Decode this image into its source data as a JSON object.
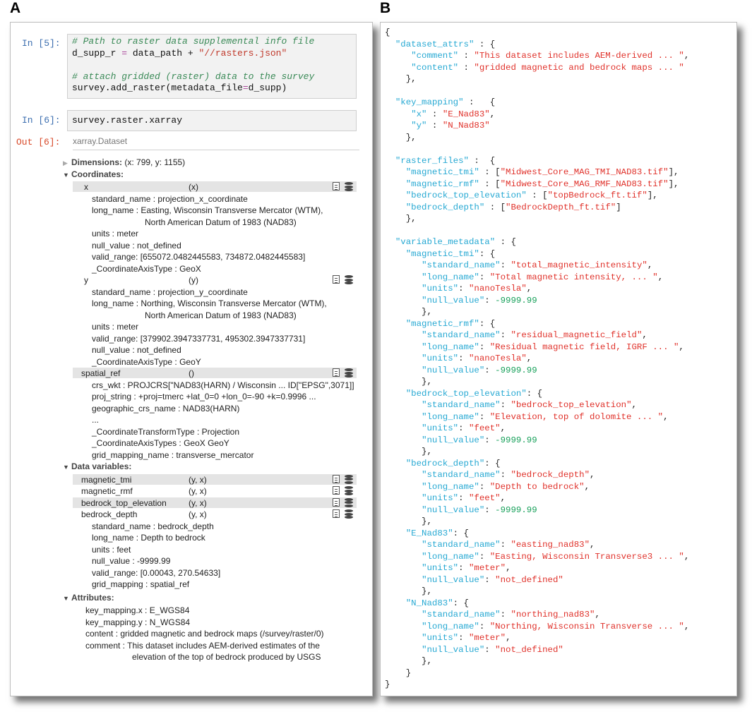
{
  "panel_labels": {
    "a": "A",
    "b": "B"
  },
  "notebook": {
    "cell5": {
      "prompt": "In [5]:",
      "lines": [
        [
          {
            "t": "# Path to raster data supplemental info file",
            "c": "comment"
          }
        ],
        [
          {
            "t": "d_supp_r ",
            "c": ""
          },
          {
            "t": "=",
            "c": "op"
          },
          {
            "t": " data_path + ",
            "c": ""
          },
          {
            "t": "\"//rasters.json\"",
            "c": "str"
          }
        ],
        [
          {
            "t": "",
            "c": ""
          }
        ],
        [
          {
            "t": "# attach gridded (raster) data to the survey",
            "c": "comment"
          }
        ],
        [
          {
            "t": "survey.add_raster(metadata_file",
            "c": ""
          },
          {
            "t": "=",
            "c": "op"
          },
          {
            "t": "d_supp)",
            "c": ""
          }
        ]
      ]
    },
    "cell6": {
      "prompt": "In [6]:",
      "code": "survey.raster.xarray",
      "out_prompt": "Out [6]:",
      "out_type": "xarray.Dataset"
    },
    "dimensions": {
      "label": "Dimensions:",
      "value": "(x: 799, y: 1155)"
    },
    "coordinates_label": "Coordinates:",
    "coords": [
      {
        "name": "x",
        "dims": "(x)",
        "attrs": [
          "standard_name : projection_x_coordinate",
          "long_name : Easting, Wisconsin Transverse Mercator (WTM),",
          "North American Datum of 1983 (NAD83)",
          "units : meter",
          "null_value : not_defined",
          "valid_range: [655072.0482445583, 734872.0482445583]",
          "_CoordinateAxisType : GeoX"
        ]
      },
      {
        "name": "y",
        "dims": "(y)",
        "attrs": [
          "standard_name : projection_y_coordinate",
          "long_name : Northing, Wisconsin Transverse Mercator (WTM),",
          "North American Datum of 1983 (NAD83)",
          "units : meter",
          "valid_range: [379902.3947337731, 495302.3947337731]",
          "null_value : not_defined",
          "_CoordinateAxisType : GeoY"
        ]
      },
      {
        "name": "spatial_ref",
        "dims": "()",
        "attrs": [
          "crs_wkt : PROJCRS[\"NAD83(HARN) / Wisconsin ... ID[\"EPSG\",3071]]",
          "proj_string : +proj=tmerc +lat_0=0 +lon_0=-90 +k=0.9996 ...",
          "geographic_crs_name : NAD83(HARN)",
          "...",
          "_CoordinateTransformType : Projection",
          "_CoordinateAxisTypes : GeoX GeoY",
          "grid_mapping_name : transverse_mercator"
        ]
      }
    ],
    "data_variables_label": "Data variables:",
    "data_vars": [
      {
        "name": "magnetic_tmi",
        "dims": "(y, x)"
      },
      {
        "name": "magnetic_rmf",
        "dims": "(y, x)"
      },
      {
        "name": "bedrock_top_elevation",
        "dims": "(y, x)"
      },
      {
        "name": "bedrock_depth",
        "dims": "(y, x)"
      }
    ],
    "bedrock_depth_attrs": [
      "standard_name : bedrock_depth",
      "long_name : Depth to bedrock",
      "units : feet",
      "null_value : -9999.99",
      "valid_range: [0.00043, 270.54633]",
      "grid_mapping : spatial_ref"
    ],
    "attributes_label": "Attributes:",
    "attributes": [
      "key_mapping.x : E_WGS84",
      "key_mapping.y : N_WGS84",
      "content : gridded magnetic and bedrock maps (/survey/raster/0)",
      "comment : This dataset includes AEM-derived estimates of the",
      "elevation of the top of bedrock produced by USGS"
    ]
  },
  "json_lines": [
    [
      {
        "t": "{",
        "c": ""
      }
    ],
    [
      {
        "t": "  ",
        "c": ""
      },
      {
        "t": "\"dataset_attrs\"",
        "c": "key"
      },
      {
        "t": " : {",
        "c": ""
      }
    ],
    [
      {
        "t": "     ",
        "c": ""
      },
      {
        "t": "\"comment\"",
        "c": "key"
      },
      {
        "t": " : ",
        "c": ""
      },
      {
        "t": "\"This dataset includes AEM-derived ... \"",
        "c": "str"
      },
      {
        "t": ",",
        "c": ""
      }
    ],
    [
      {
        "t": "     ",
        "c": ""
      },
      {
        "t": "\"content\"",
        "c": "key"
      },
      {
        "t": " : ",
        "c": ""
      },
      {
        "t": "\"gridded magnetic and bedrock maps ... \"",
        "c": "str"
      }
    ],
    [
      {
        "t": "    },",
        "c": ""
      }
    ],
    [
      {
        "t": "",
        "c": ""
      }
    ],
    [
      {
        "t": "  ",
        "c": ""
      },
      {
        "t": "\"key_mapping\"",
        "c": "key"
      },
      {
        "t": " :   {",
        "c": ""
      }
    ],
    [
      {
        "t": "     ",
        "c": ""
      },
      {
        "t": "\"x\"",
        "c": "key"
      },
      {
        "t": " : ",
        "c": ""
      },
      {
        "t": "\"E_Nad83\"",
        "c": "str"
      },
      {
        "t": ",",
        "c": ""
      }
    ],
    [
      {
        "t": "     ",
        "c": ""
      },
      {
        "t": "\"y\"",
        "c": "key"
      },
      {
        "t": " : ",
        "c": ""
      },
      {
        "t": "\"N_Nad83\"",
        "c": "str"
      }
    ],
    [
      {
        "t": "    },",
        "c": ""
      }
    ],
    [
      {
        "t": "",
        "c": ""
      }
    ],
    [
      {
        "t": "  ",
        "c": ""
      },
      {
        "t": "\"raster_files\"",
        "c": "key"
      },
      {
        "t": " :  {",
        "c": ""
      }
    ],
    [
      {
        "t": "    ",
        "c": ""
      },
      {
        "t": "\"magnetic_tmi\"",
        "c": "key"
      },
      {
        "t": " : [",
        "c": ""
      },
      {
        "t": "\"Midwest_Core_MAG_TMI_NAD83.tif\"",
        "c": "str"
      },
      {
        "t": "],",
        "c": ""
      }
    ],
    [
      {
        "t": "    ",
        "c": ""
      },
      {
        "t": "\"magnetic_rmf\"",
        "c": "key"
      },
      {
        "t": " : [",
        "c": ""
      },
      {
        "t": "\"Midwest_Core_MAG_RMF_NAD83.tif\"",
        "c": "str"
      },
      {
        "t": "],",
        "c": ""
      }
    ],
    [
      {
        "t": "    ",
        "c": ""
      },
      {
        "t": "\"bedrock_top_elevation\"",
        "c": "key"
      },
      {
        "t": " : [",
        "c": ""
      },
      {
        "t": "\"topBedrock_ft.tif\"",
        "c": "str"
      },
      {
        "t": "],",
        "c": ""
      }
    ],
    [
      {
        "t": "    ",
        "c": ""
      },
      {
        "t": "\"bedrock_depth\"",
        "c": "key"
      },
      {
        "t": " : [",
        "c": ""
      },
      {
        "t": "\"BedrockDepth_ft.tif\"",
        "c": "str"
      },
      {
        "t": "]",
        "c": ""
      }
    ],
    [
      {
        "t": "    },",
        "c": ""
      }
    ],
    [
      {
        "t": "",
        "c": ""
      }
    ],
    [
      {
        "t": "  ",
        "c": ""
      },
      {
        "t": "\"variable_metadata\"",
        "c": "key"
      },
      {
        "t": " : {",
        "c": ""
      }
    ],
    [
      {
        "t": "    ",
        "c": ""
      },
      {
        "t": "\"magnetic_tmi\"",
        "c": "key"
      },
      {
        "t": ": {",
        "c": ""
      }
    ],
    [
      {
        "t": "       ",
        "c": ""
      },
      {
        "t": "\"standard_name\"",
        "c": "key"
      },
      {
        "t": ": ",
        "c": ""
      },
      {
        "t": "\"total_magnetic_intensity\"",
        "c": "str"
      },
      {
        "t": ",",
        "c": ""
      }
    ],
    [
      {
        "t": "       ",
        "c": ""
      },
      {
        "t": "\"long_name\"",
        "c": "key"
      },
      {
        "t": ": ",
        "c": ""
      },
      {
        "t": "\"Total magnetic intensity, ... \"",
        "c": "str"
      },
      {
        "t": ",",
        "c": ""
      }
    ],
    [
      {
        "t": "       ",
        "c": ""
      },
      {
        "t": "\"units\"",
        "c": "key"
      },
      {
        "t": ": ",
        "c": ""
      },
      {
        "t": "\"nanoTesla\"",
        "c": "str"
      },
      {
        "t": ",",
        "c": ""
      }
    ],
    [
      {
        "t": "       ",
        "c": ""
      },
      {
        "t": "\"null_value\"",
        "c": "key"
      },
      {
        "t": ": ",
        "c": ""
      },
      {
        "t": "-9999.99",
        "c": "num"
      }
    ],
    [
      {
        "t": "       },",
        "c": ""
      }
    ],
    [
      {
        "t": "    ",
        "c": ""
      },
      {
        "t": "\"magnetic_rmf\"",
        "c": "key"
      },
      {
        "t": ": {",
        "c": ""
      }
    ],
    [
      {
        "t": "       ",
        "c": ""
      },
      {
        "t": "\"standard_name\"",
        "c": "key"
      },
      {
        "t": ": ",
        "c": ""
      },
      {
        "t": "\"residual_magnetic_field\"",
        "c": "str"
      },
      {
        "t": ",",
        "c": ""
      }
    ],
    [
      {
        "t": "       ",
        "c": ""
      },
      {
        "t": "\"long_name\"",
        "c": "key"
      },
      {
        "t": ": ",
        "c": ""
      },
      {
        "t": "\"Residual magnetic field, IGRF ... \"",
        "c": "str"
      },
      {
        "t": ",",
        "c": ""
      }
    ],
    [
      {
        "t": "       ",
        "c": ""
      },
      {
        "t": "\"units\"",
        "c": "key"
      },
      {
        "t": ": ",
        "c": ""
      },
      {
        "t": "\"nanoTesla\"",
        "c": "str"
      },
      {
        "t": ",",
        "c": ""
      }
    ],
    [
      {
        "t": "       ",
        "c": ""
      },
      {
        "t": "\"null_value\"",
        "c": "key"
      },
      {
        "t": ": ",
        "c": ""
      },
      {
        "t": "-9999.99",
        "c": "num"
      }
    ],
    [
      {
        "t": "       },",
        "c": ""
      }
    ],
    [
      {
        "t": "    ",
        "c": ""
      },
      {
        "t": "\"bedrock_top_elevation\"",
        "c": "key"
      },
      {
        "t": ": {",
        "c": ""
      }
    ],
    [
      {
        "t": "       ",
        "c": ""
      },
      {
        "t": "\"standard_name\"",
        "c": "key"
      },
      {
        "t": ": ",
        "c": ""
      },
      {
        "t": "\"bedrock_top_elevation\"",
        "c": "str"
      },
      {
        "t": ",",
        "c": ""
      }
    ],
    [
      {
        "t": "       ",
        "c": ""
      },
      {
        "t": "\"long_name\"",
        "c": "key"
      },
      {
        "t": ": ",
        "c": ""
      },
      {
        "t": "\"Elevation, top of dolomite ... \"",
        "c": "str"
      },
      {
        "t": ",",
        "c": ""
      }
    ],
    [
      {
        "t": "       ",
        "c": ""
      },
      {
        "t": "\"units\"",
        "c": "key"
      },
      {
        "t": ": ",
        "c": ""
      },
      {
        "t": "\"feet\"",
        "c": "str"
      },
      {
        "t": ",",
        "c": ""
      }
    ],
    [
      {
        "t": "       ",
        "c": ""
      },
      {
        "t": "\"null_value\"",
        "c": "key"
      },
      {
        "t": ": ",
        "c": ""
      },
      {
        "t": "-9999.99",
        "c": "num"
      }
    ],
    [
      {
        "t": "       },",
        "c": ""
      }
    ],
    [
      {
        "t": "    ",
        "c": ""
      },
      {
        "t": "\"bedrock_depth\"",
        "c": "key"
      },
      {
        "t": ": {",
        "c": ""
      }
    ],
    [
      {
        "t": "       ",
        "c": ""
      },
      {
        "t": "\"standard_name\"",
        "c": "key"
      },
      {
        "t": ": ",
        "c": ""
      },
      {
        "t": "\"bedrock_depth\"",
        "c": "str"
      },
      {
        "t": ",",
        "c": ""
      }
    ],
    [
      {
        "t": "       ",
        "c": ""
      },
      {
        "t": "\"long_name\"",
        "c": "key"
      },
      {
        "t": ": ",
        "c": ""
      },
      {
        "t": "\"Depth to bedrock\"",
        "c": "str"
      },
      {
        "t": ",",
        "c": ""
      }
    ],
    [
      {
        "t": "       ",
        "c": ""
      },
      {
        "t": "\"units\"",
        "c": "key"
      },
      {
        "t": ": ",
        "c": ""
      },
      {
        "t": "\"feet\"",
        "c": "str"
      },
      {
        "t": ",",
        "c": ""
      }
    ],
    [
      {
        "t": "       ",
        "c": ""
      },
      {
        "t": "\"null_value\"",
        "c": "key"
      },
      {
        "t": ": ",
        "c": ""
      },
      {
        "t": "-9999.99",
        "c": "num"
      }
    ],
    [
      {
        "t": "       },",
        "c": ""
      }
    ],
    [
      {
        "t": "    ",
        "c": ""
      },
      {
        "t": "\"E_Nad83\"",
        "c": "key"
      },
      {
        "t": ": {",
        "c": ""
      }
    ],
    [
      {
        "t": "       ",
        "c": ""
      },
      {
        "t": "\"standard_name\"",
        "c": "key"
      },
      {
        "t": ": ",
        "c": ""
      },
      {
        "t": "\"easting_nad83\"",
        "c": "str"
      },
      {
        "t": ",",
        "c": ""
      }
    ],
    [
      {
        "t": "       ",
        "c": ""
      },
      {
        "t": "\"long_name\"",
        "c": "key"
      },
      {
        "t": ": ",
        "c": ""
      },
      {
        "t": "\"Easting, Wisconsin Transverse3 ... \"",
        "c": "str"
      },
      {
        "t": ",",
        "c": ""
      }
    ],
    [
      {
        "t": "       ",
        "c": ""
      },
      {
        "t": "\"units\"",
        "c": "key"
      },
      {
        "t": ": ",
        "c": ""
      },
      {
        "t": "\"meter\"",
        "c": "str"
      },
      {
        "t": ",",
        "c": ""
      }
    ],
    [
      {
        "t": "       ",
        "c": ""
      },
      {
        "t": "\"null_value\"",
        "c": "key"
      },
      {
        "t": ": ",
        "c": ""
      },
      {
        "t": "\"not_defined\"",
        "c": "str"
      }
    ],
    [
      {
        "t": "       },",
        "c": ""
      }
    ],
    [
      {
        "t": "    ",
        "c": ""
      },
      {
        "t": "\"N_Nad83\"",
        "c": "key"
      },
      {
        "t": ": {",
        "c": ""
      }
    ],
    [
      {
        "t": "       ",
        "c": ""
      },
      {
        "t": "\"standard_name\"",
        "c": "key"
      },
      {
        "t": ": ",
        "c": ""
      },
      {
        "t": "\"northing_nad83\"",
        "c": "str"
      },
      {
        "t": ",",
        "c": ""
      }
    ],
    [
      {
        "t": "       ",
        "c": ""
      },
      {
        "t": "\"long_name\"",
        "c": "key"
      },
      {
        "t": ": ",
        "c": ""
      },
      {
        "t": "\"Northing, Wisconsin Transverse ... \"",
        "c": "str"
      },
      {
        "t": ",",
        "c": ""
      }
    ],
    [
      {
        "t": "       ",
        "c": ""
      },
      {
        "t": "\"units\"",
        "c": "key"
      },
      {
        "t": ": ",
        "c": ""
      },
      {
        "t": "\"meter\"",
        "c": "str"
      },
      {
        "t": ",",
        "c": ""
      }
    ],
    [
      {
        "t": "       ",
        "c": ""
      },
      {
        "t": "\"null_value\"",
        "c": "key"
      },
      {
        "t": ": ",
        "c": ""
      },
      {
        "t": "\"not_defined\"",
        "c": "str"
      }
    ],
    [
      {
        "t": "       },",
        "c": ""
      }
    ],
    [
      {
        "t": "    }",
        "c": ""
      }
    ],
    [
      {
        "t": "}",
        "c": ""
      }
    ]
  ]
}
